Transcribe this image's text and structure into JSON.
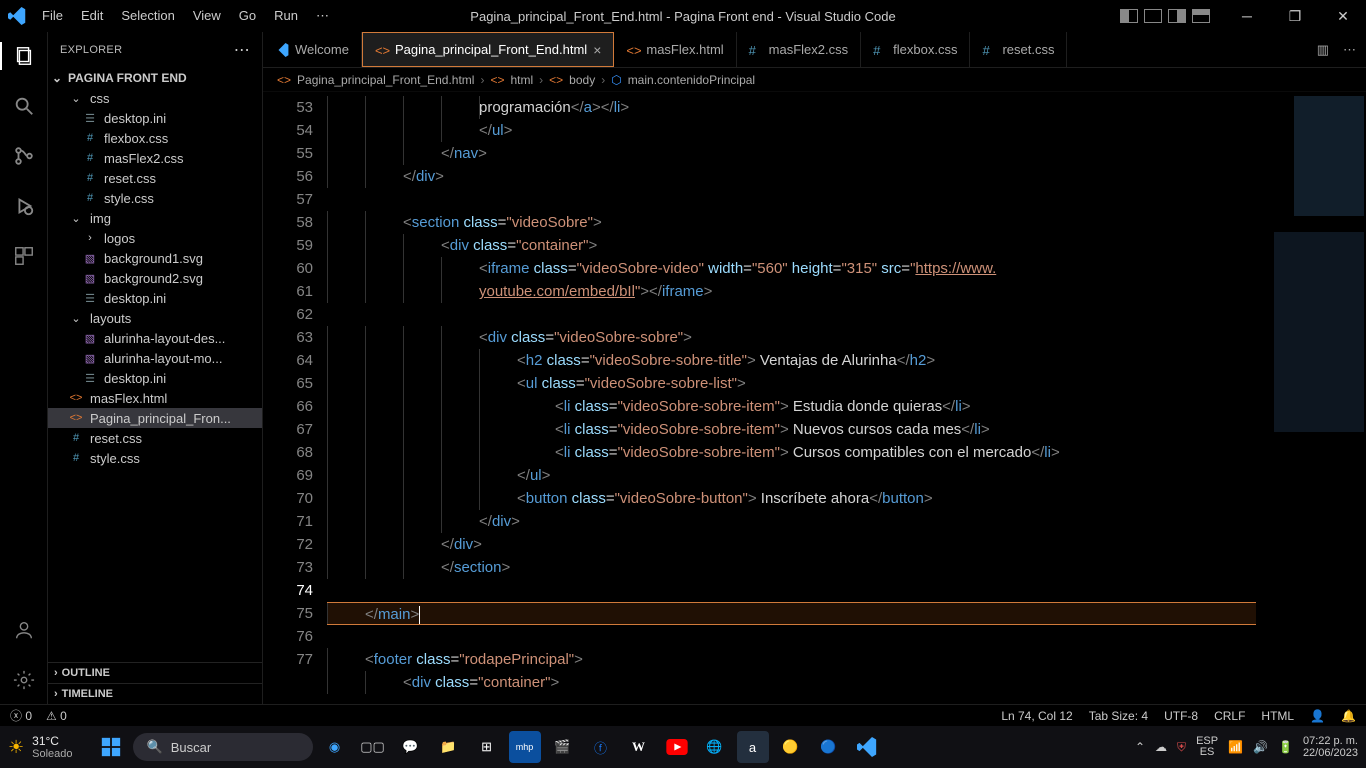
{
  "title": "Pagina_principal_Front_End.html - Pagina Front end - Visual Studio Code",
  "menus": [
    "File",
    "Edit",
    "Selection",
    "View",
    "Go",
    "Run"
  ],
  "explorer": {
    "label": "EXPLORER",
    "project": "PAGINA FRONT END",
    "tree": [
      {
        "kind": "folder",
        "open": true,
        "indent": 1,
        "label": "css"
      },
      {
        "kind": "file",
        "icon": "ini",
        "indent": 2,
        "label": "desktop.ini"
      },
      {
        "kind": "file",
        "icon": "css",
        "indent": 2,
        "label": "flexbox.css"
      },
      {
        "kind": "file",
        "icon": "css",
        "indent": 2,
        "label": "masFlex2.css"
      },
      {
        "kind": "file",
        "icon": "css",
        "indent": 2,
        "label": "reset.css"
      },
      {
        "kind": "file",
        "icon": "css",
        "indent": 2,
        "label": "style.css"
      },
      {
        "kind": "folder",
        "open": true,
        "indent": 1,
        "label": "img"
      },
      {
        "kind": "folder",
        "open": false,
        "indent": 2,
        "label": "logos"
      },
      {
        "kind": "file",
        "icon": "svg",
        "indent": 2,
        "label": "background1.svg"
      },
      {
        "kind": "file",
        "icon": "svg",
        "indent": 2,
        "label": "background2.svg"
      },
      {
        "kind": "file",
        "icon": "ini",
        "indent": 2,
        "label": "desktop.ini"
      },
      {
        "kind": "folder",
        "open": true,
        "indent": 1,
        "label": "layouts"
      },
      {
        "kind": "file",
        "icon": "svg",
        "indent": 2,
        "label": "alurinha-layout-des..."
      },
      {
        "kind": "file",
        "icon": "svg",
        "indent": 2,
        "label": "alurinha-layout-mo..."
      },
      {
        "kind": "file",
        "icon": "ini",
        "indent": 2,
        "label": "desktop.ini"
      },
      {
        "kind": "file",
        "icon": "html",
        "indent": 1,
        "label": "masFlex.html"
      },
      {
        "kind": "file",
        "icon": "html",
        "indent": 1,
        "label": "Pagina_principal_Fron...",
        "selected": true
      },
      {
        "kind": "file",
        "icon": "css",
        "indent": 1,
        "label": "reset.css"
      },
      {
        "kind": "file",
        "icon": "css",
        "indent": 1,
        "label": "style.css"
      }
    ],
    "outline": "OUTLINE",
    "timeline": "TIMELINE"
  },
  "tabs": [
    {
      "icon": "vs",
      "label": "Welcome",
      "active": false
    },
    {
      "icon": "html",
      "label": "Pagina_principal_Front_End.html",
      "active": true,
      "close": true
    },
    {
      "icon": "html",
      "label": "masFlex.html",
      "active": false
    },
    {
      "icon": "css",
      "label": "masFlex2.css",
      "active": false
    },
    {
      "icon": "css",
      "label": "flexbox.css",
      "active": false
    },
    {
      "icon": "css",
      "label": "reset.css",
      "active": false
    }
  ],
  "breadcrumb": {
    "file": "Pagina_principal_Front_End.html",
    "parts": [
      "html",
      "body",
      "main.contenidoPrincipal"
    ]
  },
  "gutter_start": 53,
  "code_lines": [
    {
      "n": 53,
      "indent": 5,
      "frag": [
        [
          "txt",
          "programación"
        ],
        [
          "brkt",
          "</"
        ],
        [
          "tag",
          "a"
        ],
        [
          "brkt",
          "></"
        ],
        [
          "tag",
          "li"
        ],
        [
          "brkt",
          ">"
        ]
      ],
      "cutoff": true
    },
    {
      "n": 54,
      "indent": 4,
      "frag": [
        [
          "brkt",
          "</"
        ],
        [
          "tag",
          "ul"
        ],
        [
          "brkt",
          ">"
        ]
      ]
    },
    {
      "n": 55,
      "indent": 3,
      "frag": [
        [
          "brkt",
          "</"
        ],
        [
          "tag",
          "nav"
        ],
        [
          "brkt",
          ">"
        ]
      ]
    },
    {
      "n": 56,
      "indent": 2,
      "frag": [
        [
          "brkt",
          "</"
        ],
        [
          "tag",
          "div"
        ],
        [
          "brkt",
          ">"
        ]
      ]
    },
    {
      "n": 57,
      "indent": 0,
      "frag": []
    },
    {
      "n": 58,
      "indent": 2,
      "frag": [
        [
          "brkt",
          "<"
        ],
        [
          "tag",
          "section"
        ],
        [
          "sp",
          " "
        ],
        [
          "attr",
          "class"
        ],
        [
          "eq",
          "="
        ],
        [
          "str",
          "\"videoSobre\""
        ],
        [
          "brkt",
          ">"
        ]
      ]
    },
    {
      "n": 59,
      "indent": 3,
      "frag": [
        [
          "brkt",
          "<"
        ],
        [
          "tag",
          "div"
        ],
        [
          "sp",
          " "
        ],
        [
          "attr",
          "class"
        ],
        [
          "eq",
          "="
        ],
        [
          "str",
          "\"container\""
        ],
        [
          "brkt",
          ">"
        ]
      ]
    },
    {
      "n": 60,
      "indent": 4,
      "frag": [
        [
          "brkt",
          "<"
        ],
        [
          "tag",
          "iframe"
        ],
        [
          "sp",
          " "
        ],
        [
          "attr",
          "class"
        ],
        [
          "eq",
          "="
        ],
        [
          "str",
          "\"videoSobre-video\""
        ],
        [
          "sp",
          " "
        ],
        [
          "attr",
          "width"
        ],
        [
          "eq",
          "="
        ],
        [
          "str",
          "\"560\""
        ],
        [
          "sp",
          " "
        ],
        [
          "attr",
          "height"
        ],
        [
          "eq",
          "="
        ],
        [
          "str",
          "\"315\""
        ],
        [
          "sp",
          " "
        ],
        [
          "attr",
          "src"
        ],
        [
          "eq",
          "="
        ],
        [
          "str",
          "\""
        ],
        [
          "url",
          "https://www."
        ]
      ]
    },
    {
      "n": "",
      "indent": 4,
      "frag": [
        [
          "url",
          "youtube.com/embed/bIl"
        ],
        [
          "str",
          "\""
        ],
        [
          "brkt",
          "></"
        ],
        [
          "tag",
          "iframe"
        ],
        [
          "brkt",
          ">"
        ]
      ]
    },
    {
      "n": 61,
      "indent": 0,
      "frag": []
    },
    {
      "n": 62,
      "indent": 4,
      "frag": [
        [
          "brkt",
          "<"
        ],
        [
          "tag",
          "div"
        ],
        [
          "sp",
          " "
        ],
        [
          "attr",
          "class"
        ],
        [
          "eq",
          "="
        ],
        [
          "str",
          "\"videoSobre-sobre\""
        ],
        [
          "brkt",
          ">"
        ]
      ]
    },
    {
      "n": 63,
      "indent": 5,
      "frag": [
        [
          "brkt",
          "<"
        ],
        [
          "tag",
          "h2"
        ],
        [
          "sp",
          " "
        ],
        [
          "attr",
          "class"
        ],
        [
          "eq",
          "="
        ],
        [
          "str",
          "\"videoSobre-sobre-title\""
        ],
        [
          "brkt",
          ">"
        ],
        [
          "txt",
          " Ventajas de Alurinha"
        ],
        [
          "brkt",
          "</"
        ],
        [
          "tag",
          "h2"
        ],
        [
          "brkt",
          ">"
        ]
      ]
    },
    {
      "n": 64,
      "indent": 5,
      "frag": [
        [
          "brkt",
          "<"
        ],
        [
          "tag",
          "ul"
        ],
        [
          "sp",
          " "
        ],
        [
          "attr",
          "class"
        ],
        [
          "eq",
          "="
        ],
        [
          "str",
          "\"videoSobre-sobre-list\""
        ],
        [
          "brkt",
          ">"
        ]
      ]
    },
    {
      "n": 65,
      "indent": 6,
      "frag": [
        [
          "brkt",
          "<"
        ],
        [
          "tag",
          "li"
        ],
        [
          "sp",
          " "
        ],
        [
          "attr",
          "class"
        ],
        [
          "eq",
          "="
        ],
        [
          "str",
          "\"videoSobre-sobre-item\""
        ],
        [
          "brkt",
          ">"
        ],
        [
          "txt",
          " Estudia donde quieras"
        ],
        [
          "brkt",
          "</"
        ],
        [
          "tag",
          "li"
        ],
        [
          "brkt",
          ">"
        ]
      ]
    },
    {
      "n": 66,
      "indent": 6,
      "frag": [
        [
          "brkt",
          "<"
        ],
        [
          "tag",
          "li"
        ],
        [
          "sp",
          " "
        ],
        [
          "attr",
          "class"
        ],
        [
          "eq",
          "="
        ],
        [
          "str",
          "\"videoSobre-sobre-item\""
        ],
        [
          "brkt",
          ">"
        ],
        [
          "txt",
          " Nuevos cursos cada mes"
        ],
        [
          "brkt",
          "</"
        ],
        [
          "tag",
          "li"
        ],
        [
          "brkt",
          ">"
        ]
      ]
    },
    {
      "n": 67,
      "indent": 6,
      "frag": [
        [
          "brkt",
          "<"
        ],
        [
          "tag",
          "li"
        ],
        [
          "sp",
          " "
        ],
        [
          "attr",
          "class"
        ],
        [
          "eq",
          "="
        ],
        [
          "str",
          "\"videoSobre-sobre-item\""
        ],
        [
          "brkt",
          ">"
        ],
        [
          "txt",
          " Cursos compatibles con el mercado"
        ],
        [
          "brkt",
          "</"
        ],
        [
          "tag",
          "li"
        ],
        [
          "brkt",
          ">"
        ]
      ]
    },
    {
      "n": 68,
      "indent": 5,
      "frag": [
        [
          "brkt",
          "</"
        ],
        [
          "tag",
          "ul"
        ],
        [
          "brkt",
          ">"
        ]
      ]
    },
    {
      "n": 69,
      "indent": 5,
      "frag": [
        [
          "brkt",
          "<"
        ],
        [
          "tag",
          "button"
        ],
        [
          "sp",
          " "
        ],
        [
          "attr",
          "class"
        ],
        [
          "eq",
          "="
        ],
        [
          "str",
          "\"videoSobre-button\""
        ],
        [
          "brkt",
          ">"
        ],
        [
          "txt",
          " Inscríbete ahora"
        ],
        [
          "brkt",
          "</"
        ],
        [
          "tag",
          "button"
        ],
        [
          "brkt",
          ">"
        ]
      ]
    },
    {
      "n": 70,
      "indent": 4,
      "frag": [
        [
          "brkt",
          "</"
        ],
        [
          "tag",
          "div"
        ],
        [
          "brkt",
          ">"
        ]
      ]
    },
    {
      "n": 71,
      "indent": 3,
      "frag": [
        [
          "brkt",
          "</"
        ],
        [
          "tag",
          "div"
        ],
        [
          "brkt",
          ">"
        ]
      ]
    },
    {
      "n": 72,
      "indent": 3,
      "frag": [
        [
          "brkt",
          "</"
        ],
        [
          "tag",
          "section"
        ],
        [
          "brkt",
          ">"
        ]
      ]
    },
    {
      "n": 73,
      "indent": 0,
      "frag": []
    },
    {
      "n": 74,
      "indent": 1,
      "frag": [
        [
          "brkt",
          "</"
        ],
        [
          "tag",
          "main"
        ],
        [
          "brkt",
          ">"
        ]
      ],
      "current": true,
      "cursor": true
    },
    {
      "n": 75,
      "indent": 0,
      "frag": []
    },
    {
      "n": 76,
      "indent": 1,
      "frag": [
        [
          "brkt",
          "<"
        ],
        [
          "tag",
          "footer"
        ],
        [
          "sp",
          " "
        ],
        [
          "attr",
          "class"
        ],
        [
          "eq",
          "="
        ],
        [
          "str",
          "\"rodapePrincipal\""
        ],
        [
          "brkt",
          ">"
        ]
      ]
    },
    {
      "n": 77,
      "indent": 2,
      "frag": [
        [
          "brkt",
          "<"
        ],
        [
          "tag",
          "div"
        ],
        [
          "sp",
          " "
        ],
        [
          "attr",
          "class"
        ],
        [
          "eq",
          "="
        ],
        [
          "str",
          "\"container\""
        ],
        [
          "brkt",
          ">"
        ]
      ]
    }
  ],
  "status": {
    "errors": "0",
    "warnings": "0",
    "ln": "Ln 74, Col 12",
    "tab": "Tab Size: 4",
    "enc": "UTF-8",
    "eol": "CRLF",
    "lang": "HTML"
  },
  "taskbar": {
    "temp": "31°C",
    "weather": "Soleado",
    "search": "Buscar",
    "lang1": "ESP",
    "lang2": "ES",
    "time": "07:22 p. m.",
    "date": "22/06/2023"
  }
}
